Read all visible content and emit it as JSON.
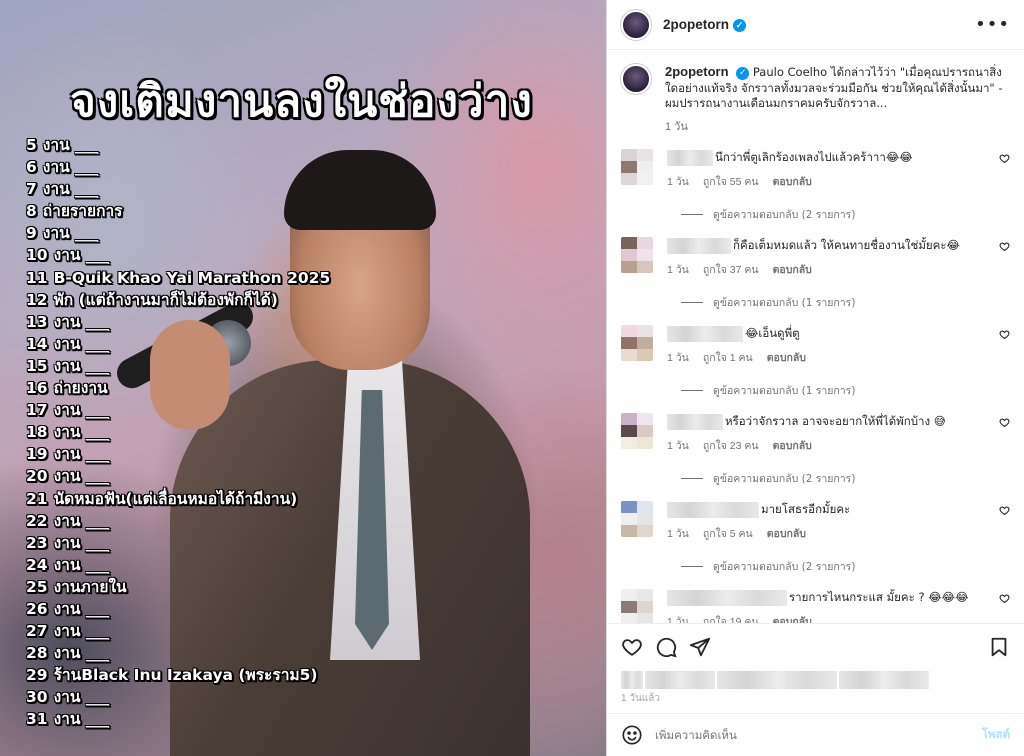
{
  "image": {
    "title": "จงเติมงานลงในช่องว่าง",
    "schedule": [
      {
        "day": "5",
        "text": "งาน ___"
      },
      {
        "day": "6",
        "text": "งาน ___"
      },
      {
        "day": "7",
        "text": "งาน ___"
      },
      {
        "day": "8",
        "text": "ถ่ายรายการ"
      },
      {
        "day": "9",
        "text": "งาน ___"
      },
      {
        "day": "10",
        "text": "งาน ___"
      },
      {
        "day": "11",
        "text": "B-Quik Khao Yai Marathon 2025"
      },
      {
        "day": "12",
        "text": "พัก (แต่ถ้างานมาก็ไม่ต้องพักก็ได้)"
      },
      {
        "day": "13",
        "text": "งาน ___"
      },
      {
        "day": "14",
        "text": "งาน ___"
      },
      {
        "day": "15",
        "text": "งาน ___"
      },
      {
        "day": "16",
        "text": "ถ่ายงาน"
      },
      {
        "day": "17",
        "text": "งาน ___"
      },
      {
        "day": "18",
        "text": "งาน ___"
      },
      {
        "day": "19",
        "text": "งาน ___"
      },
      {
        "day": "20",
        "text": "งาน ___"
      },
      {
        "day": "21",
        "text": "นัดหมอฟัน(แต่เลื่อนหมอได้ถ้ามีงาน)"
      },
      {
        "day": "22",
        "text": "งาน ___"
      },
      {
        "day": "23",
        "text": "งาน ___"
      },
      {
        "day": "24",
        "text": "งาน ___"
      },
      {
        "day": "25",
        "text": "งานภายใน"
      },
      {
        "day": "26",
        "text": "งาน ___"
      },
      {
        "day": "27",
        "text": "งาน ___"
      },
      {
        "day": "28",
        "text": "งาน ___"
      },
      {
        "day": "29",
        "text": "ร้านBlack Inu Izakaya (พระราม5)"
      },
      {
        "day": "30",
        "text": "งาน ___"
      },
      {
        "day": "31",
        "text": "งาน ___"
      }
    ]
  },
  "header": {
    "username": "2popetorn",
    "verified_mark": "✓",
    "more_label": "•••"
  },
  "caption": {
    "username": "2popetorn",
    "text": "Paulo Coelho ได้กล่าวไว้ว่า \"เมื่อคุณปรารถนาสิ่งใดอย่างแท้จริง จักรวาลทั้งมวลจะร่วมมือกัน ช่วยให้คุณได้สิ่งนั้นมา\" - ผมปรารถนางานเดือนมกราคมครับจักรวาล...",
    "time": "1 วัน"
  },
  "comments": [
    {
      "text": "นึกว่าพี่ตูเลิกร้องเพลงไปแล้วคร้าาา😂😂",
      "time": "1 วัน",
      "likes": "ถูกใจ 55 คน",
      "reply": "ตอบกลับ",
      "replies": "ดูข้อความตอบกลับ (2 รายการ)",
      "blur_w": 46,
      "avatar": [
        "#d9d3d4",
        "#e8e4e5",
        "#8c7a72",
        "#efefef",
        "#dcd7d6",
        "#f2f1f1"
      ]
    },
    {
      "text": "ก็คือเต็มหมดแล้ว ให้คนทายชื่องานใช่มั้ยคะ😂",
      "time": "1 วัน",
      "likes": "ถูกใจ 37 คน",
      "reply": "ตอบกลับ",
      "replies": "ดูข้อความตอบกลับ (1 รายการ)",
      "blur_w": 64,
      "avatar": [
        "#7a6358",
        "#e8d7de",
        "#e2c7d3",
        "#f1e2ea",
        "#bba08f",
        "#d8c6bd"
      ]
    },
    {
      "text": "😂เอ็นดูพี่ตู",
      "time": "1 วัน",
      "likes": "ถูกใจ 1 คน",
      "reply": "ตอบกลับ",
      "replies": "ดูข้อความตอบกลับ (1 รายการ)",
      "blur_w": 76,
      "avatar": [
        "#f0d8e2",
        "#e9e2e6",
        "#8f7566",
        "#bfae9d",
        "#e6dcd0",
        "#dcc9b3"
      ]
    },
    {
      "text": "หรือว่าจักรวาล อาจจะอยากให้พี่ได้พักบ้าง 😅",
      "time": "1 วัน",
      "likes": "ถูกใจ 23 คน",
      "reply": "ตอบกลับ",
      "replies": "ดูข้อความตอบกลับ (2 รายการ)",
      "blur_w": 56,
      "avatar": [
        "#c9b3c9",
        "#efe5ef",
        "#5b4a4c",
        "#dcc9c5",
        "#f0ede1",
        "#ece7d6"
      ]
    },
    {
      "text": "มายโสธรอีกมั้ยคะ",
      "time": "1 วัน",
      "likes": "ถูกใจ 5 คน",
      "reply": "ตอบกลับ",
      "replies": "ดูข้อความตอบกลับ (2 รายการ)",
      "blur_w": 92,
      "avatar": [
        "#7a93c2",
        "#dfe4f0",
        "#efefef",
        "#e5e5e5",
        "#c9b7a8",
        "#e0d6cc"
      ]
    },
    {
      "text": "รายการไหนกระแส มั้ยคะ ? 😂😂😂",
      "time": "1 วัน",
      "likes": "ถูกใจ 19 คน",
      "reply": "ตอบกลับ",
      "replies": "",
      "blur_w": 120,
      "avatar": [
        "#efefef",
        "#e8e8e8",
        "#8d7a75",
        "#dcd6d2",
        "#efefef",
        "#e6e6e6"
      ]
    }
  ],
  "actions": {
    "post_time": "1 วันแล้ว"
  },
  "comment_bar": {
    "placeholder": "เพิ่มความคิดเห็น",
    "post_label": "โพสต์"
  },
  "colors": {
    "verified": "#0095f6",
    "post_button_disabled": "#b2dffc",
    "muted_text": "#737373"
  }
}
